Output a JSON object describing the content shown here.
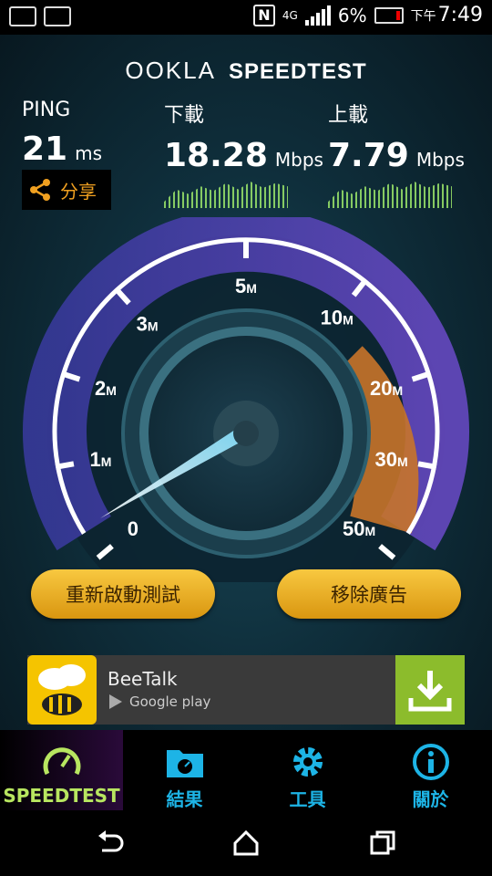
{
  "status_bar": {
    "nfc": "N",
    "network": "4G",
    "battery_percent": "6%",
    "ampm": "下午",
    "time": "7:49"
  },
  "header": {
    "brand": "OOKLA",
    "product": "SPEEDTEST"
  },
  "results": {
    "ping": {
      "label": "PING",
      "value": "21",
      "unit": "ms"
    },
    "download": {
      "label": "下載",
      "value": "18.28",
      "unit": "Mbps"
    },
    "upload": {
      "label": "上載",
      "value": "7.79",
      "unit": "Mbps"
    },
    "share_label": "分享"
  },
  "gauge": {
    "ticks": [
      "0",
      "1M",
      "2M",
      "3M",
      "5M",
      "10M",
      "20M",
      "30M",
      "50M"
    ],
    "needle_value": "0"
  },
  "buttons": {
    "retest": "重新啟動測試",
    "remove_ads": "移除廣告"
  },
  "ad": {
    "title": "BeeTalk",
    "store": "Google play"
  },
  "tabs": [
    {
      "label": "SPEEDTEST",
      "icon": "speedometer-icon"
    },
    {
      "label": "結果",
      "icon": "results-folder-icon"
    },
    {
      "label": "工具",
      "icon": "gear-icon"
    },
    {
      "label": "關於",
      "icon": "info-icon"
    }
  ],
  "colors": {
    "accent_gold": "#f0a020",
    "tab_blue": "#1db4e6",
    "active_green": "#b8e660",
    "download_green": "#8cbc2c"
  }
}
